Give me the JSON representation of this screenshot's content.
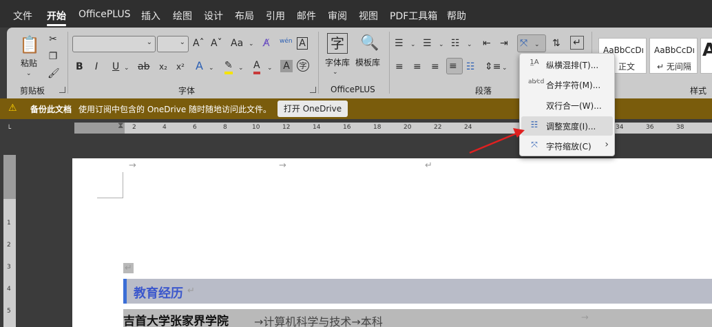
{
  "menu_tabs": [
    "文件",
    "开始",
    "OfficePLUS",
    "插入",
    "绘图",
    "设计",
    "布局",
    "引用",
    "邮件",
    "审阅",
    "视图",
    "PDF工具箱",
    "帮助"
  ],
  "ribbon": {
    "clipboard": {
      "paste_label": "粘贴",
      "group_label": "剪贴板"
    },
    "font": {
      "group_label": "字体",
      "grow": "Aˆ",
      "shrink": "Aˇ",
      "case": "Aa",
      "bold": "B",
      "italic": "I",
      "underline": "U",
      "strike": "ab",
      "sub": "x₂",
      "sup": "x²",
      "phonetic": "wén",
      "border": "A",
      "highlight": "A",
      "color": "A",
      "shade": "A",
      "circle": "字"
    },
    "officeplus": {
      "group_label": "OfficePLUS",
      "fonts_label": "字体库",
      "template_label": "模板库",
      "fonts_icon": "字"
    },
    "paragraph": {
      "group_label": "段落"
    },
    "styles": {
      "group_label": "样式",
      "items": [
        {
          "sample": "AaBbCcDı",
          "name": "正文"
        },
        {
          "sample": "AaBbCcDı",
          "name": "↵ 无间隔"
        },
        {
          "sample": "A",
          "name": ""
        }
      ]
    }
  },
  "infobar": {
    "title": "备份此文档",
    "message": "使用订阅中包含的 OneDrive 随时随地访问此文件。",
    "button": "打开 OneDrive"
  },
  "ruler_numbers": [
    "2",
    "4",
    "6",
    "8",
    "10",
    "12",
    "14",
    "16",
    "18",
    "20",
    "22",
    "24",
    "34",
    "36",
    "38"
  ],
  "vruler_numbers": [
    "1",
    "2",
    "3",
    "4",
    "5"
  ],
  "dropdown": {
    "items": [
      {
        "icon": "1̲A",
        "label": "纵横混排(T)...",
        "highlight": false,
        "submenu": false
      },
      {
        "icon": "ab⁄cd",
        "label": "合并字符(M)...",
        "highlight": false,
        "submenu": false
      },
      {
        "icon": "",
        "label": "双行合一(W)...",
        "highlight": false,
        "submenu": false
      },
      {
        "icon": "☷",
        "label": "调整宽度(I)...",
        "highlight": true,
        "submenu": false
      },
      {
        "icon": "⤧",
        "label": "字符缩放(C)",
        "highlight": false,
        "submenu": true
      }
    ]
  },
  "document": {
    "heading": "教育经历",
    "school": "吉首大学张家界学院",
    "school_rest": "→计算机科学与技术→本科",
    "tab_mark": "→",
    "para_mark": "↵"
  },
  "colors": {
    "accent": "#3b6ed6",
    "infobar": "#7a5c0c",
    "arrow": "#e02020"
  }
}
